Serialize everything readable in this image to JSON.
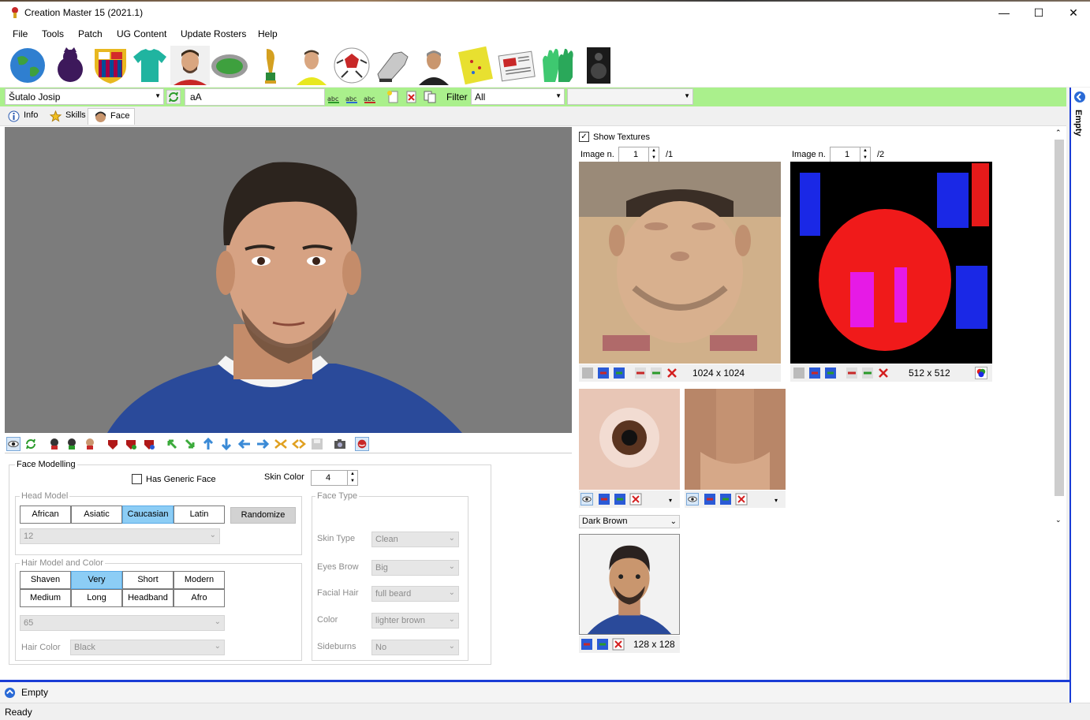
{
  "window": {
    "title": "Creation Master 15 (2021.1)",
    "minimize": "—",
    "maximize": "☐",
    "close": "✕"
  },
  "menu": [
    "File",
    "Tools",
    "Patch",
    "UG Content",
    "Update Rosters",
    "Help"
  ],
  "toolbar": {
    "player_select": "Šutalo Josip",
    "case_label": "aA",
    "filter_label": "Filter",
    "filter_value": "All",
    "second_filter": ""
  },
  "tabs": [
    "Info",
    "Skills",
    "Face"
  ],
  "face_modelling": {
    "title": "Face Modelling",
    "has_generic_face": "Has Generic Face",
    "skin_color_label": "Skin Color",
    "skin_color_value": "4",
    "head_model": {
      "title": "Head Model",
      "buttons": [
        "African",
        "Asiatic",
        "Caucasian",
        "Latin"
      ],
      "selected": "Caucasian",
      "randomize": "Randomize",
      "model_value": "12"
    },
    "hair": {
      "title": "Hair Model and Color",
      "buttons": [
        "Shaven",
        "Very",
        "Short",
        "Modern",
        "Medium",
        "Long",
        "Headband",
        "Afro"
      ],
      "selected": "Very",
      "model_value": "65",
      "hair_color_label": "Hair Color",
      "hair_color_value": "Black"
    },
    "face_type": {
      "title": "Face Type",
      "skin_type_label": "Skin Type",
      "skin_type_value": "Clean",
      "eyes_brow_label": "Eyes Brow",
      "eyes_brow_value": "Big",
      "facial_hair_label": "Facial Hair",
      "facial_hair_value": "full beard",
      "color_label": "Color",
      "color_value": "lighter brown",
      "sideburns_label": "Sideburns",
      "sideburns_value": "No"
    }
  },
  "textures": {
    "show_textures": "Show Textures",
    "image_label": "Image n.",
    "tex1_index": "1",
    "tex1_total": "/1",
    "tex1_size": "1024 x 1024",
    "tex2_index": "1",
    "tex2_total": "/2",
    "tex2_size": "512 x 512",
    "eye_color": "Dark Brown",
    "mini_size": "128 x 128"
  },
  "sidebar": {
    "label": "Empty"
  },
  "bottom": {
    "label": "Empty"
  },
  "status": {
    "text": "Ready"
  },
  "colors": {
    "toolbar_green": "#aaf08c",
    "selected_blue": "#8ccdf5",
    "accent": "#1a3cd6"
  }
}
